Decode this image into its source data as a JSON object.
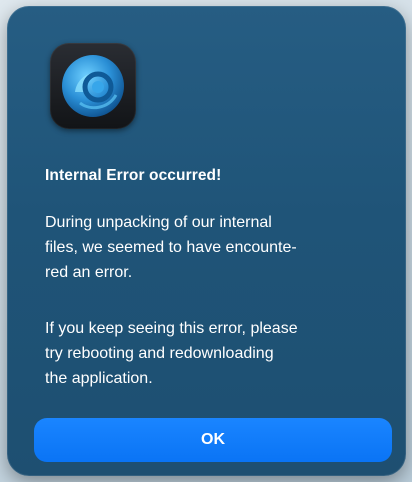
{
  "dialog": {
    "app_icon": "app-orb-icon",
    "title": "Internal Error occurred!",
    "message_1_lines": [
      "During unpacking of our internal",
      "files, we seemed to have encounte-",
      "red an error."
    ],
    "message_2_lines": [
      "If you keep seeing this error, please",
      "try rebooting and redownloading",
      "the application."
    ],
    "ok_label": "OK"
  },
  "colors": {
    "dialog_background": "#215779",
    "button_accent": "#0a7aff",
    "text": "#ffffff"
  }
}
